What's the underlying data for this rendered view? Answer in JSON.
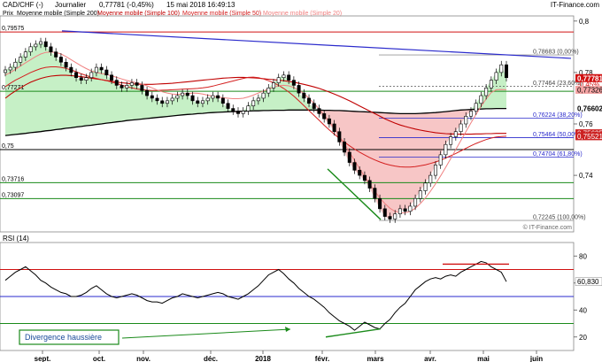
{
  "header": {
    "symbol": "CAD/CHF (-)",
    "period": "Journalier",
    "last_change": "0,77781 (-0,45%)",
    "timestamp": "15 mai 2018 16:49:13",
    "brand": "IT-Finance.com",
    "copyright": "© IT-Finance.com"
  },
  "legend": {
    "price_label": "Prix",
    "ma200": "Moyenne mobile (Simple 200)",
    "ma100": "Moyenne mobile (Simple 100)",
    "ma50": "Moyenne mobile (Simple 50)",
    "ma20": "Moyenne mobile (Simple 20)"
  },
  "colors": {
    "candle_up": "#ffffff",
    "candle_down": "#000000",
    "ma200": "#000000",
    "ma100": "#c00000",
    "ma50": "#d42020",
    "ma20": "#f08080",
    "trendline_blue": "#2a2acc",
    "support_green": "#1a8a1a",
    "fib_blue": "#2a2acc",
    "resistance_red": "#d01010",
    "last_price_bg": "#d01010",
    "ma_label_bg": "#cc2222",
    "green_fill": "#c6f0c6",
    "red_fill": "#f7c6c6"
  },
  "chart_data": [
    {
      "type": "candlestick",
      "title": "CAD/CHF (-) Journalier",
      "ylim": [
        0.718,
        0.802
      ],
      "x_ticks": [
        "sept.",
        "oct.",
        "nov.",
        "déc.",
        "2018",
        "févr.",
        "mars",
        "avr.",
        "mai",
        "juin"
      ],
      "y_ticks": [
        0.8,
        0.78,
        0.76,
        0.74
      ],
      "y_tick_labels": [
        "0,8",
        "0,78",
        "0,76",
        "0,74"
      ],
      "horizontal_levels": [
        {
          "value": 0.79575,
          "label": "0,79575",
          "color": "#d01010"
        },
        {
          "value": 0.77271,
          "label": "0,77271",
          "color": "#1a8a1a"
        },
        {
          "value": 0.75,
          "label": "0,75",
          "color": "#000000"
        },
        {
          "value": 0.73716,
          "label": "0,73716",
          "color": "#1a8a1a"
        },
        {
          "value": 0.73097,
          "label": "0,73097",
          "color": "#1a8a1a"
        }
      ],
      "fibonacci": [
        {
          "value": 0.78683,
          "label": "0,78683 (0,00%)"
        },
        {
          "value": 0.77464,
          "label": "0,77464 (23,60%)"
        },
        {
          "value": 0.76224,
          "label": "0,76224 (38,20%)"
        },
        {
          "value": 0.75464,
          "label": "0,75464 (50,00%)"
        },
        {
          "value": 0.74704,
          "label": "0,74704 (61,80%)"
        },
        {
          "value": 0.72245,
          "label": "0,72245 (100,00%)"
        }
      ],
      "right_labels": [
        {
          "value": 0.77781,
          "label": "0,77781",
          "kind": "last"
        },
        {
          "value": 0.7755,
          "label": "-0,45%",
          "kind": "change"
        },
        {
          "value": 0.77326,
          "label": "0,77326",
          "kind": "ma20"
        },
        {
          "value": 0.76602,
          "label": "0,76602",
          "kind": "ma200"
        },
        {
          "value": 0.75635,
          "label": "0,75635",
          "kind": "ma100"
        },
        {
          "value": 0.75521,
          "label": "0,75521",
          "kind": "ma50"
        }
      ],
      "close_series": [
        0.781,
        0.782,
        0.784,
        0.786,
        0.788,
        0.79,
        0.791,
        0.792,
        0.79,
        0.788,
        0.786,
        0.784,
        0.782,
        0.78,
        0.778,
        0.777,
        0.778,
        0.78,
        0.782,
        0.781,
        0.779,
        0.777,
        0.775,
        0.774,
        0.775,
        0.776,
        0.775,
        0.773,
        0.771,
        0.77,
        0.769,
        0.768,
        0.769,
        0.77,
        0.771,
        0.772,
        0.771,
        0.769,
        0.768,
        0.769,
        0.77,
        0.771,
        0.77,
        0.768,
        0.766,
        0.765,
        0.764,
        0.765,
        0.767,
        0.769,
        0.77,
        0.772,
        0.774,
        0.776,
        0.778,
        0.779,
        0.777,
        0.775,
        0.772,
        0.77,
        0.768,
        0.766,
        0.764,
        0.762,
        0.76,
        0.757,
        0.753,
        0.749,
        0.745,
        0.742,
        0.74,
        0.738,
        0.735,
        0.731,
        0.727,
        0.724,
        0.723,
        0.725,
        0.727,
        0.726,
        0.728,
        0.731,
        0.734,
        0.737,
        0.74,
        0.744,
        0.748,
        0.752,
        0.755,
        0.757,
        0.76,
        0.763,
        0.765,
        0.768,
        0.771,
        0.774,
        0.777,
        0.78,
        0.783,
        0.778
      ],
      "ma200": [
        0.7555,
        0.7557,
        0.7559,
        0.7561,
        0.7563,
        0.7566,
        0.7568,
        0.757,
        0.7573,
        0.7575,
        0.7578,
        0.758,
        0.7583,
        0.7585,
        0.7588,
        0.759,
        0.7593,
        0.7595,
        0.7598,
        0.76,
        0.7603,
        0.7605,
        0.7608,
        0.761,
        0.7613,
        0.7615,
        0.7617,
        0.7619,
        0.7621,
        0.7623,
        0.7625,
        0.7627,
        0.7629,
        0.7631,
        0.7633,
        0.7635,
        0.7637,
        0.7638,
        0.764,
        0.7641,
        0.7643,
        0.7644,
        0.7645,
        0.7646,
        0.7647,
        0.7648,
        0.7649,
        0.765,
        0.765,
        0.7651,
        0.7651,
        0.7652,
        0.7652,
        0.7653,
        0.7653,
        0.7653,
        0.7654,
        0.7654,
        0.7654,
        0.7654,
        0.7654,
        0.7654,
        0.7654,
        0.7653,
        0.7653,
        0.7652,
        0.7652,
        0.7651,
        0.765,
        0.7649,
        0.7648,
        0.7647,
        0.7646,
        0.7645,
        0.7644,
        0.7643,
        0.7642,
        0.7641,
        0.764,
        0.764,
        0.764,
        0.764,
        0.7641,
        0.7642,
        0.7643,
        0.7644,
        0.7646,
        0.7648,
        0.765,
        0.7652,
        0.7654,
        0.7655,
        0.7656,
        0.7657,
        0.7658,
        0.7659,
        0.7659,
        0.766,
        0.766,
        0.766
      ],
      "ma100": [
        0.77,
        0.7715,
        0.7728,
        0.774,
        0.7752,
        0.7762,
        0.777,
        0.7777,
        0.7782,
        0.7786,
        0.7788,
        0.7789,
        0.7789,
        0.7788,
        0.7786,
        0.7784,
        0.7781,
        0.7778,
        0.7775,
        0.7772,
        0.7769,
        0.7766,
        0.7763,
        0.776,
        0.7758,
        0.7756,
        0.7755,
        0.7754,
        0.7754,
        0.7754,
        0.7755,
        0.7756,
        0.7757,
        0.7758,
        0.776,
        0.7762,
        0.7764,
        0.7766,
        0.7768,
        0.777,
        0.7772,
        0.7774,
        0.7776,
        0.7778,
        0.7779,
        0.778,
        0.7781,
        0.7781,
        0.778,
        0.7779,
        0.7778,
        0.7776,
        0.7774,
        0.7772,
        0.777,
        0.7768,
        0.7765,
        0.7762,
        0.7758,
        0.7754,
        0.7749,
        0.7744,
        0.7738,
        0.7731,
        0.7724,
        0.7716,
        0.7708,
        0.7699,
        0.769,
        0.768,
        0.767,
        0.766,
        0.765,
        0.764,
        0.763,
        0.762,
        0.7611,
        0.7603,
        0.7596,
        0.759,
        0.7585,
        0.758,
        0.7576,
        0.7572,
        0.7569,
        0.7566,
        0.7564,
        0.7562,
        0.7561,
        0.756,
        0.756,
        0.756,
        0.756,
        0.7561,
        0.7561,
        0.7562,
        0.7562,
        0.7563,
        0.7563,
        0.7563
      ],
      "ma50": [
        0.7745,
        0.7758,
        0.777,
        0.778,
        0.779,
        0.78,
        0.7808,
        0.7815,
        0.782,
        0.7822,
        0.7822,
        0.782,
        0.7816,
        0.781,
        0.7803,
        0.7795,
        0.7788,
        0.7782,
        0.7777,
        0.7772,
        0.7768,
        0.7763,
        0.7757,
        0.7751,
        0.7745,
        0.774,
        0.7736,
        0.7733,
        0.7731,
        0.773,
        0.773,
        0.7731,
        0.7732,
        0.7733,
        0.7734,
        0.7735,
        0.7736,
        0.7737,
        0.7738,
        0.774,
        0.7743,
        0.7747,
        0.7752,
        0.7757,
        0.7762,
        0.7767,
        0.7772,
        0.7777,
        0.7781,
        0.7782,
        0.778,
        0.7775,
        0.7768,
        0.776,
        0.775,
        0.7738,
        0.7724,
        0.7708,
        0.769,
        0.7671,
        0.7652,
        0.7633,
        0.7614,
        0.7595,
        0.7577,
        0.756,
        0.7544,
        0.7529,
        0.7515,
        0.7502,
        0.749,
        0.7479,
        0.7469,
        0.746,
        0.7452,
        0.7445,
        0.744,
        0.7436,
        0.7433,
        0.7432,
        0.7432,
        0.7434,
        0.7437,
        0.7441,
        0.7446,
        0.7452,
        0.7459,
        0.7467,
        0.7476,
        0.7485,
        0.7495,
        0.7505,
        0.7515,
        0.7524,
        0.7532,
        0.7539,
        0.7545,
        0.7549,
        0.7551,
        0.7552
      ],
      "ma20": [
        0.779,
        0.78,
        0.7812,
        0.7825,
        0.7838,
        0.785,
        0.7862,
        0.7872,
        0.7878,
        0.788,
        0.7878,
        0.7872,
        0.7862,
        0.785,
        0.7838,
        0.7826,
        0.7815,
        0.7806,
        0.78,
        0.7796,
        0.7792,
        0.7787,
        0.7781,
        0.7775,
        0.7769,
        0.7764,
        0.776,
        0.7755,
        0.7748,
        0.774,
        0.7732,
        0.7725,
        0.772,
        0.7716,
        0.7715,
        0.7716,
        0.7718,
        0.772,
        0.7719,
        0.7716,
        0.7712,
        0.7708,
        0.7705,
        0.7702,
        0.77,
        0.7698,
        0.7698,
        0.77,
        0.7705,
        0.7712,
        0.772,
        0.7728,
        0.7736,
        0.7743,
        0.7748,
        0.775,
        0.7748,
        0.7742,
        0.7732,
        0.7718,
        0.77,
        0.768,
        0.7658,
        0.7634,
        0.7609,
        0.7582,
        0.7553,
        0.7522,
        0.749,
        0.7458,
        0.7426,
        0.7395,
        0.7366,
        0.7338,
        0.7312,
        0.729,
        0.7272,
        0.726,
        0.7254,
        0.7254,
        0.726,
        0.7272,
        0.729,
        0.7312,
        0.7338,
        0.7367,
        0.7398,
        0.7431,
        0.7465,
        0.75,
        0.7535,
        0.757,
        0.7604,
        0.7637,
        0.7668,
        0.7697,
        0.7722,
        0.7733,
        0.7734,
        0.7733
      ]
    },
    {
      "type": "line",
      "title": "RSI (14)",
      "ylim": [
        10,
        90
      ],
      "y_ticks": [
        80,
        60,
        40,
        20
      ],
      "y_tick_labels": [
        "80",
        "60",
        "40",
        "20"
      ],
      "levels": [
        {
          "value": 70,
          "color": "#d01010"
        },
        {
          "value": 50,
          "color": "#2a2acc"
        },
        {
          "value": 30,
          "color": "#1a8a1a"
        }
      ],
      "last_value": "60,830",
      "annotation": "Divergence haussière",
      "values": [
        62,
        65,
        68,
        70,
        72,
        69,
        66,
        62,
        60,
        57,
        55,
        53,
        52,
        50,
        50,
        51,
        53,
        56,
        58,
        55,
        52,
        50,
        49,
        50,
        51,
        52,
        51,
        49,
        47,
        46,
        46,
        45,
        47,
        49,
        50,
        52,
        51,
        50,
        49,
        50,
        51,
        52,
        53,
        52,
        50,
        49,
        48,
        50,
        52,
        55,
        58,
        62,
        66,
        68,
        70,
        67,
        63,
        60,
        56,
        53,
        50,
        48,
        45,
        42,
        38,
        35,
        32,
        30,
        28,
        25,
        28,
        31,
        29,
        27,
        26,
        30,
        33,
        38,
        42,
        45,
        50,
        55,
        58,
        61,
        63,
        64,
        63,
        65,
        66,
        65,
        68,
        70,
        72,
        74,
        76,
        75,
        72,
        70,
        68,
        61
      ]
    }
  ]
}
